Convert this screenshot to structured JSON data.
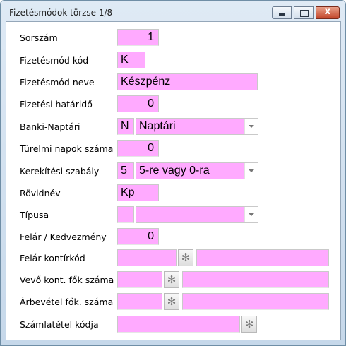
{
  "window": {
    "title": "Fizetésmódok törzse   1/8",
    "close_glyph": "x"
  },
  "form": {
    "sorszam": {
      "label": "Sorszám",
      "value": "1"
    },
    "fizetesmod_kod": {
      "label": "Fizetésmód kód",
      "value": "K"
    },
    "fizetesmod_neve": {
      "label": "Fizetésmód neve",
      "value": "Készpénz"
    },
    "fizetesi_hatarido": {
      "label": "Fizetési határidő",
      "value": "0"
    },
    "banki_naptari": {
      "label": "Banki-Naptári",
      "code": "N",
      "value": "Naptári"
    },
    "turelmi_napok": {
      "label": "Türelmi napok száma",
      "value": "0"
    },
    "kerekitesi_szabaly": {
      "label": "Kerekítési szabály",
      "code": "5",
      "value": "5-re vagy 0-ra"
    },
    "rovidnev": {
      "label": "Rövidnév",
      "value": "Kp"
    },
    "tipusa": {
      "label": "Típusa",
      "code": "",
      "value": ""
    },
    "felar_kedvezmeny": {
      "label": "Felár / Kedvezmény",
      "value": "0"
    },
    "felar_kontirkod": {
      "label": "Felár kontírkód",
      "value": "",
      "desc": ""
    },
    "vevo_kont_fok": {
      "label": "Vevő kont. fők száma",
      "value": "",
      "desc": ""
    },
    "arbevetel_fok": {
      "label": "Árbevétel fők. száma",
      "value": "",
      "desc": ""
    },
    "szamlatetel_kodja": {
      "label": "Számlatétel kódja",
      "value": ""
    }
  },
  "icons": {
    "lookup": "gear-icon",
    "lookup_glyph": "✻"
  },
  "colors": {
    "field_bg": "#ffaaff",
    "titlebar": "#c6d8ea",
    "close": "#c2462a"
  }
}
